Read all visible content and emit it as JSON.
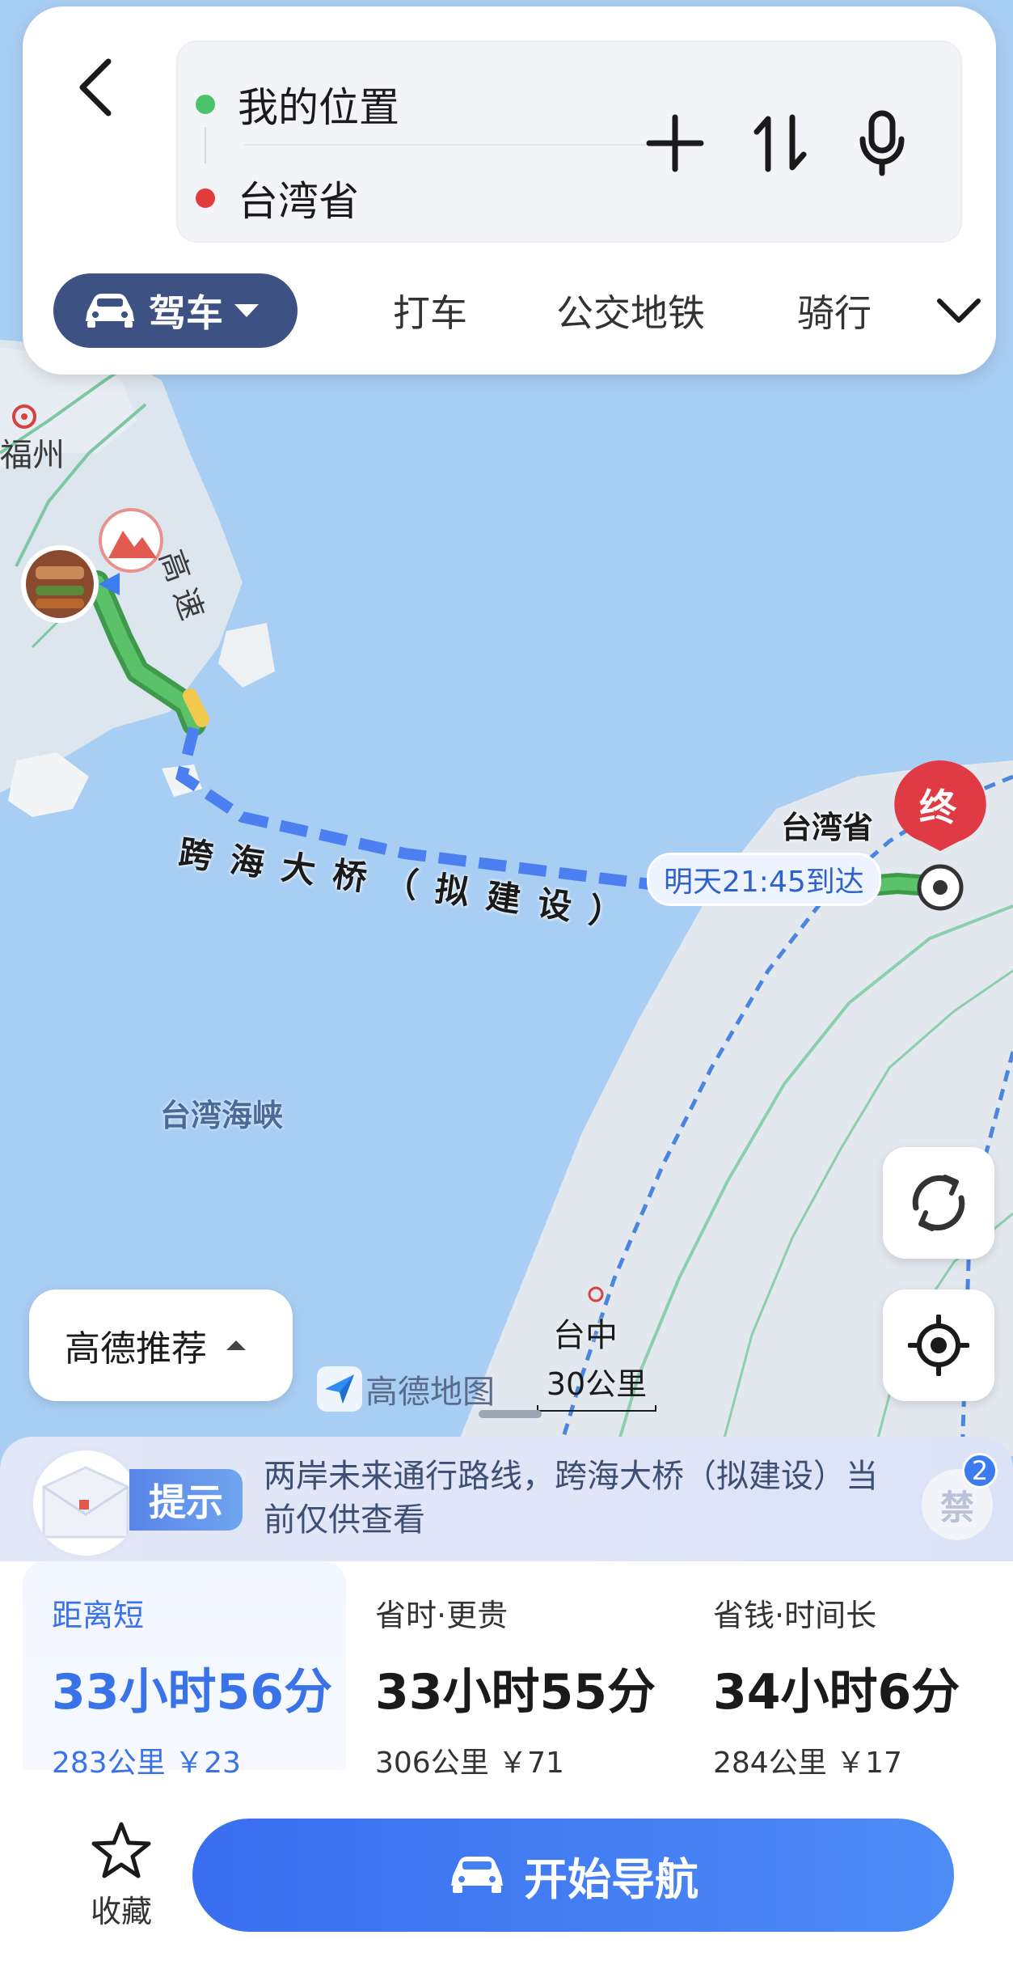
{
  "search": {
    "origin": "我的位置",
    "destination": "台湾省"
  },
  "modes": {
    "selected": "驾车",
    "others": [
      "打车",
      "公交地铁",
      "骑行"
    ]
  },
  "map": {
    "city_fuzhou": "福州",
    "highway": "高速",
    "bridge": "跨海大桥（拟建设）",
    "dest_name": "台湾省",
    "end_marker": "终",
    "arrival": "明天21:45到达",
    "strait": "台湾海峡",
    "taichung": "台中",
    "logo": "高德地图",
    "scale": "30公里"
  },
  "controls": {
    "recommend": "高德推荐"
  },
  "tip": {
    "badge": "提示",
    "text": "两岸未来通行路线，跨海大桥（拟建设）当前仅供查看",
    "ban_icon": "禁",
    "ban_count": "2"
  },
  "routes": [
    {
      "tag": "距离短",
      "time": "33小时56分",
      "meta": "283公里 ￥23"
    },
    {
      "tag": "省时·更贵",
      "time": "33小时55分",
      "meta": "306公里 ￥71"
    },
    {
      "tag": "省钱·时间长",
      "time": "34小时6分",
      "meta": "284公里 ￥17"
    }
  ],
  "footer": {
    "favorite": "收藏",
    "start_nav": "开始导航"
  },
  "colors": {
    "accent": "#3a72e8",
    "route_green": "#4caf50",
    "destination_red": "#e03a45"
  }
}
